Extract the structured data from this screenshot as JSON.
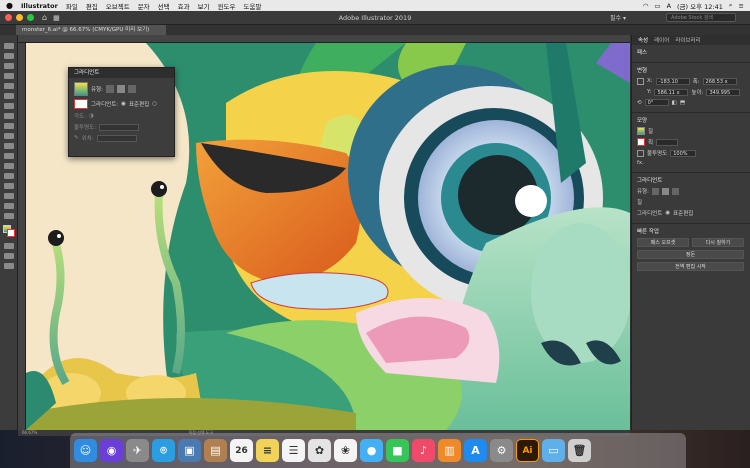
{
  "menubar": {
    "apple": "",
    "app": "Illustrator",
    "items": [
      "파일",
      "편집",
      "오브젝트",
      "문자",
      "선택",
      "효과",
      "보기",
      "윈도우",
      "도움말"
    ],
    "clock": "(금) 오후 12:41"
  },
  "window": {
    "title": "Adobe Illustrator 2019",
    "workspace": "필수 ▾",
    "stock_placeholder": "Adobe Stock 검색"
  },
  "document_tab": {
    "label": "monster_6.ai* @ 66.67% (CMYK/GPU 미리 보기)"
  },
  "gradient_panel": {
    "title": "그라디언트",
    "type_label": "유형:",
    "stroke_label": "획:",
    "edit_label": "그라디언트:",
    "edit_option": "표준편집",
    "angle_label": "각도:",
    "aspect_label": "종횡비:",
    "opacity_label": "불투명도:",
    "location_label": "위치:"
  },
  "properties_panel": {
    "tabs": [
      "속성",
      "레이어",
      "라이브러리"
    ],
    "path_label": "패스",
    "transform_label": "변형",
    "x_label": "X:",
    "x_value": "-183.10",
    "y_label": "Y:",
    "y_value": "586.11 x",
    "w_label": "폭:",
    "w_value": "268.53 x",
    "h_label": "높이:",
    "h_value": "349.995",
    "angle_value": "0°",
    "appearance_label": "모양",
    "fill_label": "칠",
    "stroke_label": "획",
    "opacity_label": "불투명도",
    "opacity_value": "100%",
    "fx_label": "fx.",
    "gradient_label": "그라디언트",
    "gradient_type_label": "유형:",
    "gradient_fill_label": "칠",
    "gradient_edit_label": "그라디언트",
    "gradient_edit_option": "표준편집",
    "quick_actions_label": "빠른 작업",
    "btn_offset_path": "패스 오프셋",
    "btn_recolor": "다시 칠하기",
    "btn_arrange": "정돈",
    "btn_edit_mode": "전역 편집 시작"
  },
  "status": {
    "zoom": "66.67%",
    "info": "직접 선택 도구"
  },
  "dock": {
    "items": [
      {
        "name": "finder",
        "color": "#2f8ce0",
        "glyph": "☺"
      },
      {
        "name": "siri",
        "color": "#6a3fd8",
        "glyph": "◉"
      },
      {
        "name": "launchpad",
        "color": "#8a8a8a",
        "glyph": "✈"
      },
      {
        "name": "safari",
        "color": "#2a9ee0",
        "glyph": "⌾"
      },
      {
        "name": "preview",
        "color": "#4a7ab0",
        "glyph": "▣"
      },
      {
        "name": "contacts",
        "color": "#b08050",
        "glyph": "▤"
      },
      {
        "name": "calendar",
        "color": "#f4f4f4",
        "glyph": "26"
      },
      {
        "name": "notes",
        "color": "#f1d35a",
        "glyph": "≡"
      },
      {
        "name": "reminders",
        "color": "#f4f4f4",
        "glyph": "☰"
      },
      {
        "name": "photos-app",
        "color": "#e4e4e4",
        "glyph": "✿"
      },
      {
        "name": "photos",
        "color": "#f4f4f4",
        "glyph": "❀"
      },
      {
        "name": "messages",
        "color": "#43b0f4",
        "glyph": "●"
      },
      {
        "name": "facetime",
        "color": "#37c55a",
        "glyph": "■"
      },
      {
        "name": "music",
        "color": "#f04a6a",
        "glyph": "♪"
      },
      {
        "name": "books",
        "color": "#ef8a2a",
        "glyph": "▥"
      },
      {
        "name": "app-store",
        "color": "#1f8af0",
        "glyph": "A"
      },
      {
        "name": "system-prefs",
        "color": "#8a8a8a",
        "glyph": "⚙"
      },
      {
        "name": "illustrator",
        "color": "#2a1a06",
        "glyph": "Ai"
      },
      {
        "name": "folder",
        "color": "#5fb0e8",
        "glyph": "▭"
      },
      {
        "name": "trash",
        "color": "#cfcfcf",
        "glyph": "🗑"
      }
    ],
    "calendar_date": "26"
  },
  "colors": {
    "accent": "#ff9a00",
    "bg": "#323232"
  }
}
